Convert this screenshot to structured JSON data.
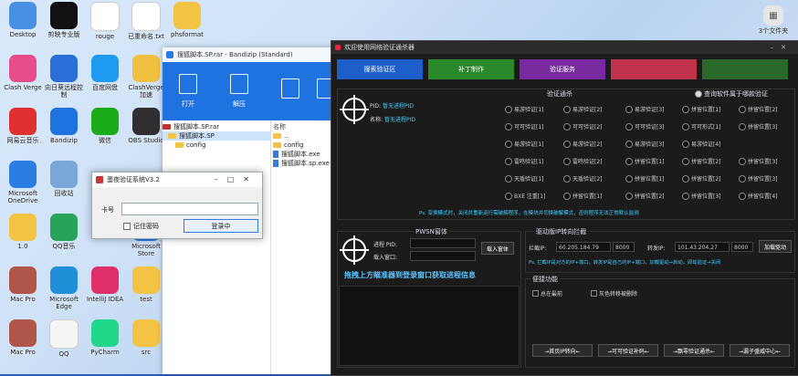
{
  "desktop": {
    "icons": [
      {
        "label": "Desktop",
        "color": "#4a90e2"
      },
      {
        "label": "剪映专业版",
        "color": "#111111"
      },
      {
        "label": "rouge",
        "color": "#ffffff"
      },
      {
        "label": "已重命名.txt",
        "color": "#ffffff"
      },
      {
        "label": "phsformat",
        "color": "#f3c344"
      },
      {
        "label": "Clash Verge",
        "color": "#e74c8b"
      },
      {
        "label": "向日葵远程控制",
        "color": "#2a6fd8"
      },
      {
        "label": "百度网盘",
        "color": "#1e9bf0"
      },
      {
        "label": "ClashVerge 加速",
        "color": "#f0c040"
      },
      {
        "label": "网易云音乐",
        "color": "#e03030"
      },
      {
        "label": "Bandizip",
        "color": "#1f73e0"
      },
      {
        "label": "微信",
        "color": "#1aad19"
      },
      {
        "label": "OBS Studio",
        "color": "#302e31"
      },
      {
        "label": "Microsoft OneDrive",
        "color": "#2a7de1"
      },
      {
        "label": "回收站",
        "color": "#7aa7d8"
      },
      {
        "label": "1.0",
        "color": "#f3c344"
      },
      {
        "label": "QQ音乐",
        "color": "#27a35a"
      },
      {
        "label": "Microsoft Store",
        "color": "#2a7de1"
      },
      {
        "label": "Mac Pro",
        "color": "#b0554a"
      },
      {
        "label": "Microsoft Edge",
        "color": "#1f8fd8"
      },
      {
        "label": "IntelliJ IDEA",
        "color": "#e0306a"
      },
      {
        "label": "test",
        "color": "#f3c344"
      },
      {
        "label": "Mac Pro",
        "color": "#b0554a"
      },
      {
        "label": "QQ",
        "color": "#f5f5f5"
      },
      {
        "label": "PyCharm",
        "color": "#21d789"
      },
      {
        "label": "src",
        "color": "#f3c344"
      }
    ],
    "topright_label": "3个文件夹"
  },
  "bandizip": {
    "title": "搜狐脚本.SP.rar - Bandizip (Standard)",
    "toolbar": [
      "打开",
      "解压",
      "",
      ""
    ],
    "tree": [
      "搜狐脚本.SP.rar",
      "搜狐脚本.SP",
      "config"
    ],
    "files_header": "名称",
    "files": [
      "..",
      "config",
      "搜狐脚本.exe",
      "搜狐脚本.sp.exe"
    ]
  },
  "login": {
    "title": "蛋夜验证系统V3.2",
    "card_label": "卡号",
    "card_value": "",
    "remember": "记住密码",
    "submit": "登录中"
  },
  "tool": {
    "title": "欢迎使用网络验证通杀器",
    "tabs": [
      {
        "label": "搜索验证区",
        "color": "#1d5ec8"
      },
      {
        "label": "补丁制作",
        "color": "#2a8a2a"
      },
      {
        "label": "验证服务",
        "color": "#7a2aa0"
      },
      {
        "label": "",
        "color": "#c0334a"
      },
      {
        "label": "",
        "color": "#2a6a2a"
      }
    ],
    "verify_section": "验证通杀",
    "query_label": "查询软件属于哪款验证",
    "pid_label": "PID:",
    "pid_value": "暂无进程PID",
    "name_label": "名称:",
    "name_value": "暂无进程PID",
    "checks": [
      [
        "易游验证[1]",
        "易游验证[2]",
        "易游验证[3]",
        "拼留位置[1]",
        "拼留位置[2]"
      ],
      [
        "可可验证[1]",
        "可可验证[2]",
        "可可验证[3]",
        "可可形式[1]",
        "拼留位置[3]"
      ],
      [
        "易游验证[1]",
        "易游验证[2]",
        "易游验证[3]",
        "易游验证[4]",
        ""
      ],
      [
        "雷鸣验证[1]",
        "雷鸣验证[2]",
        "拼留位置[1]",
        "拼留位置[2]",
        "拼留位置[3]"
      ],
      [
        "天盾验证[1]",
        "天盾验证[2]",
        "拼留位置[1]",
        "拼留位置[2]",
        "拼留位置[3]"
      ],
      [
        "BXE 注重[1]",
        "拼留位置[1]",
        "拼留位置[2]",
        "拼留位置[3]",
        "拼留位置[4]"
      ]
    ],
    "hint": "Ps. 变换模式时，关闭并重新运行需破解程序，在模块并切换破解模式，否则程序无法正常默认监测",
    "pwsn_section": "PWSN窗体",
    "proc_pid_label": "进程 PID:",
    "load_window_label": "载入窗口:",
    "load_button": "载入窗体",
    "drag_hint": "拖拽上方瞄准器到登录窗口获取进程信息",
    "drive_section": "驱动版IP转向拦截",
    "block_ip_label": "拦截IP:",
    "block_ip": "60.205.184.79",
    "block_port": "8000",
    "redirect_ip_label": "转发IP:",
    "redirect_ip": "101.43.204.27",
    "redirect_port": "8000",
    "load_driver": "加载驱动",
    "drive_hint": "Ps. 拦截IP是对方的IP+端口，转发IP是自己的IP+端口，加载驱动→启动，即劫验证→关闭",
    "quick_section": "便捷功能",
    "top_checkbox": "总在最前",
    "gray_checkbox": "灰色转移被删除",
    "bottom_buttons": [
      "→首页IP转向←",
      "→可可验证补码←",
      "→飘零验证通杀←",
      "→漏子盛威中心←"
    ]
  },
  "colors": {
    "tool_bg": "#1b1b1b",
    "accent": "#3fd0ff",
    "hint": "#3fd0ff",
    "drag_hint": "#5fc4ff"
  }
}
